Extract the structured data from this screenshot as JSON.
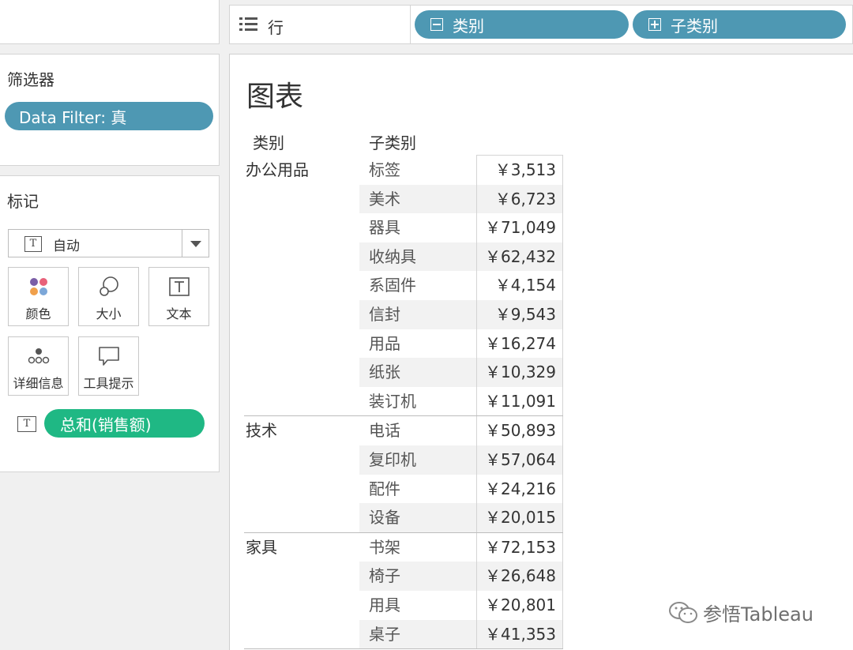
{
  "shelf": {
    "rows_label": "行",
    "pills": [
      "类别",
      "子类别"
    ]
  },
  "filters": {
    "title": "筛选器",
    "items": [
      "Data Filter: 真"
    ]
  },
  "marks": {
    "title": "标记",
    "type_select": "自动",
    "buttons": [
      {
        "label": "颜色",
        "icon": "color-icon"
      },
      {
        "label": "大小",
        "icon": "size-icon"
      },
      {
        "label": "文本",
        "icon": "text-icon"
      },
      {
        "label": "详细信息",
        "icon": "detail-icon"
      },
      {
        "label": "工具提示",
        "icon": "tooltip-icon"
      }
    ],
    "measure_pill": "总和(销售额)"
  },
  "view": {
    "title": "图表",
    "headers": {
      "category": "类别",
      "subcategory": "子类别"
    },
    "groups": [
      {
        "category": "办公用品",
        "rows": [
          {
            "sub": "标签",
            "value": "￥3,513"
          },
          {
            "sub": "美术",
            "value": "￥6,723"
          },
          {
            "sub": "器具",
            "value": "￥71,049"
          },
          {
            "sub": "收纳具",
            "value": "￥62,432"
          },
          {
            "sub": "系固件",
            "value": "￥4,154"
          },
          {
            "sub": "信封",
            "value": "￥9,543"
          },
          {
            "sub": "用品",
            "value": "￥16,274"
          },
          {
            "sub": "纸张",
            "value": "￥10,329"
          },
          {
            "sub": "装订机",
            "value": "￥11,091"
          }
        ]
      },
      {
        "category": "技术",
        "rows": [
          {
            "sub": "电话",
            "value": "￥50,893"
          },
          {
            "sub": "复印机",
            "value": "￥57,064"
          },
          {
            "sub": "配件",
            "value": "￥24,216"
          },
          {
            "sub": "设备",
            "value": "￥20,015"
          }
        ]
      },
      {
        "category": "家具",
        "rows": [
          {
            "sub": "书架",
            "value": "￥72,153"
          },
          {
            "sub": "椅子",
            "value": "￥26,648"
          },
          {
            "sub": "用具",
            "value": "￥20,801"
          },
          {
            "sub": "桌子",
            "value": "￥41,353"
          }
        ]
      }
    ]
  },
  "watermark": "参悟Tableau"
}
